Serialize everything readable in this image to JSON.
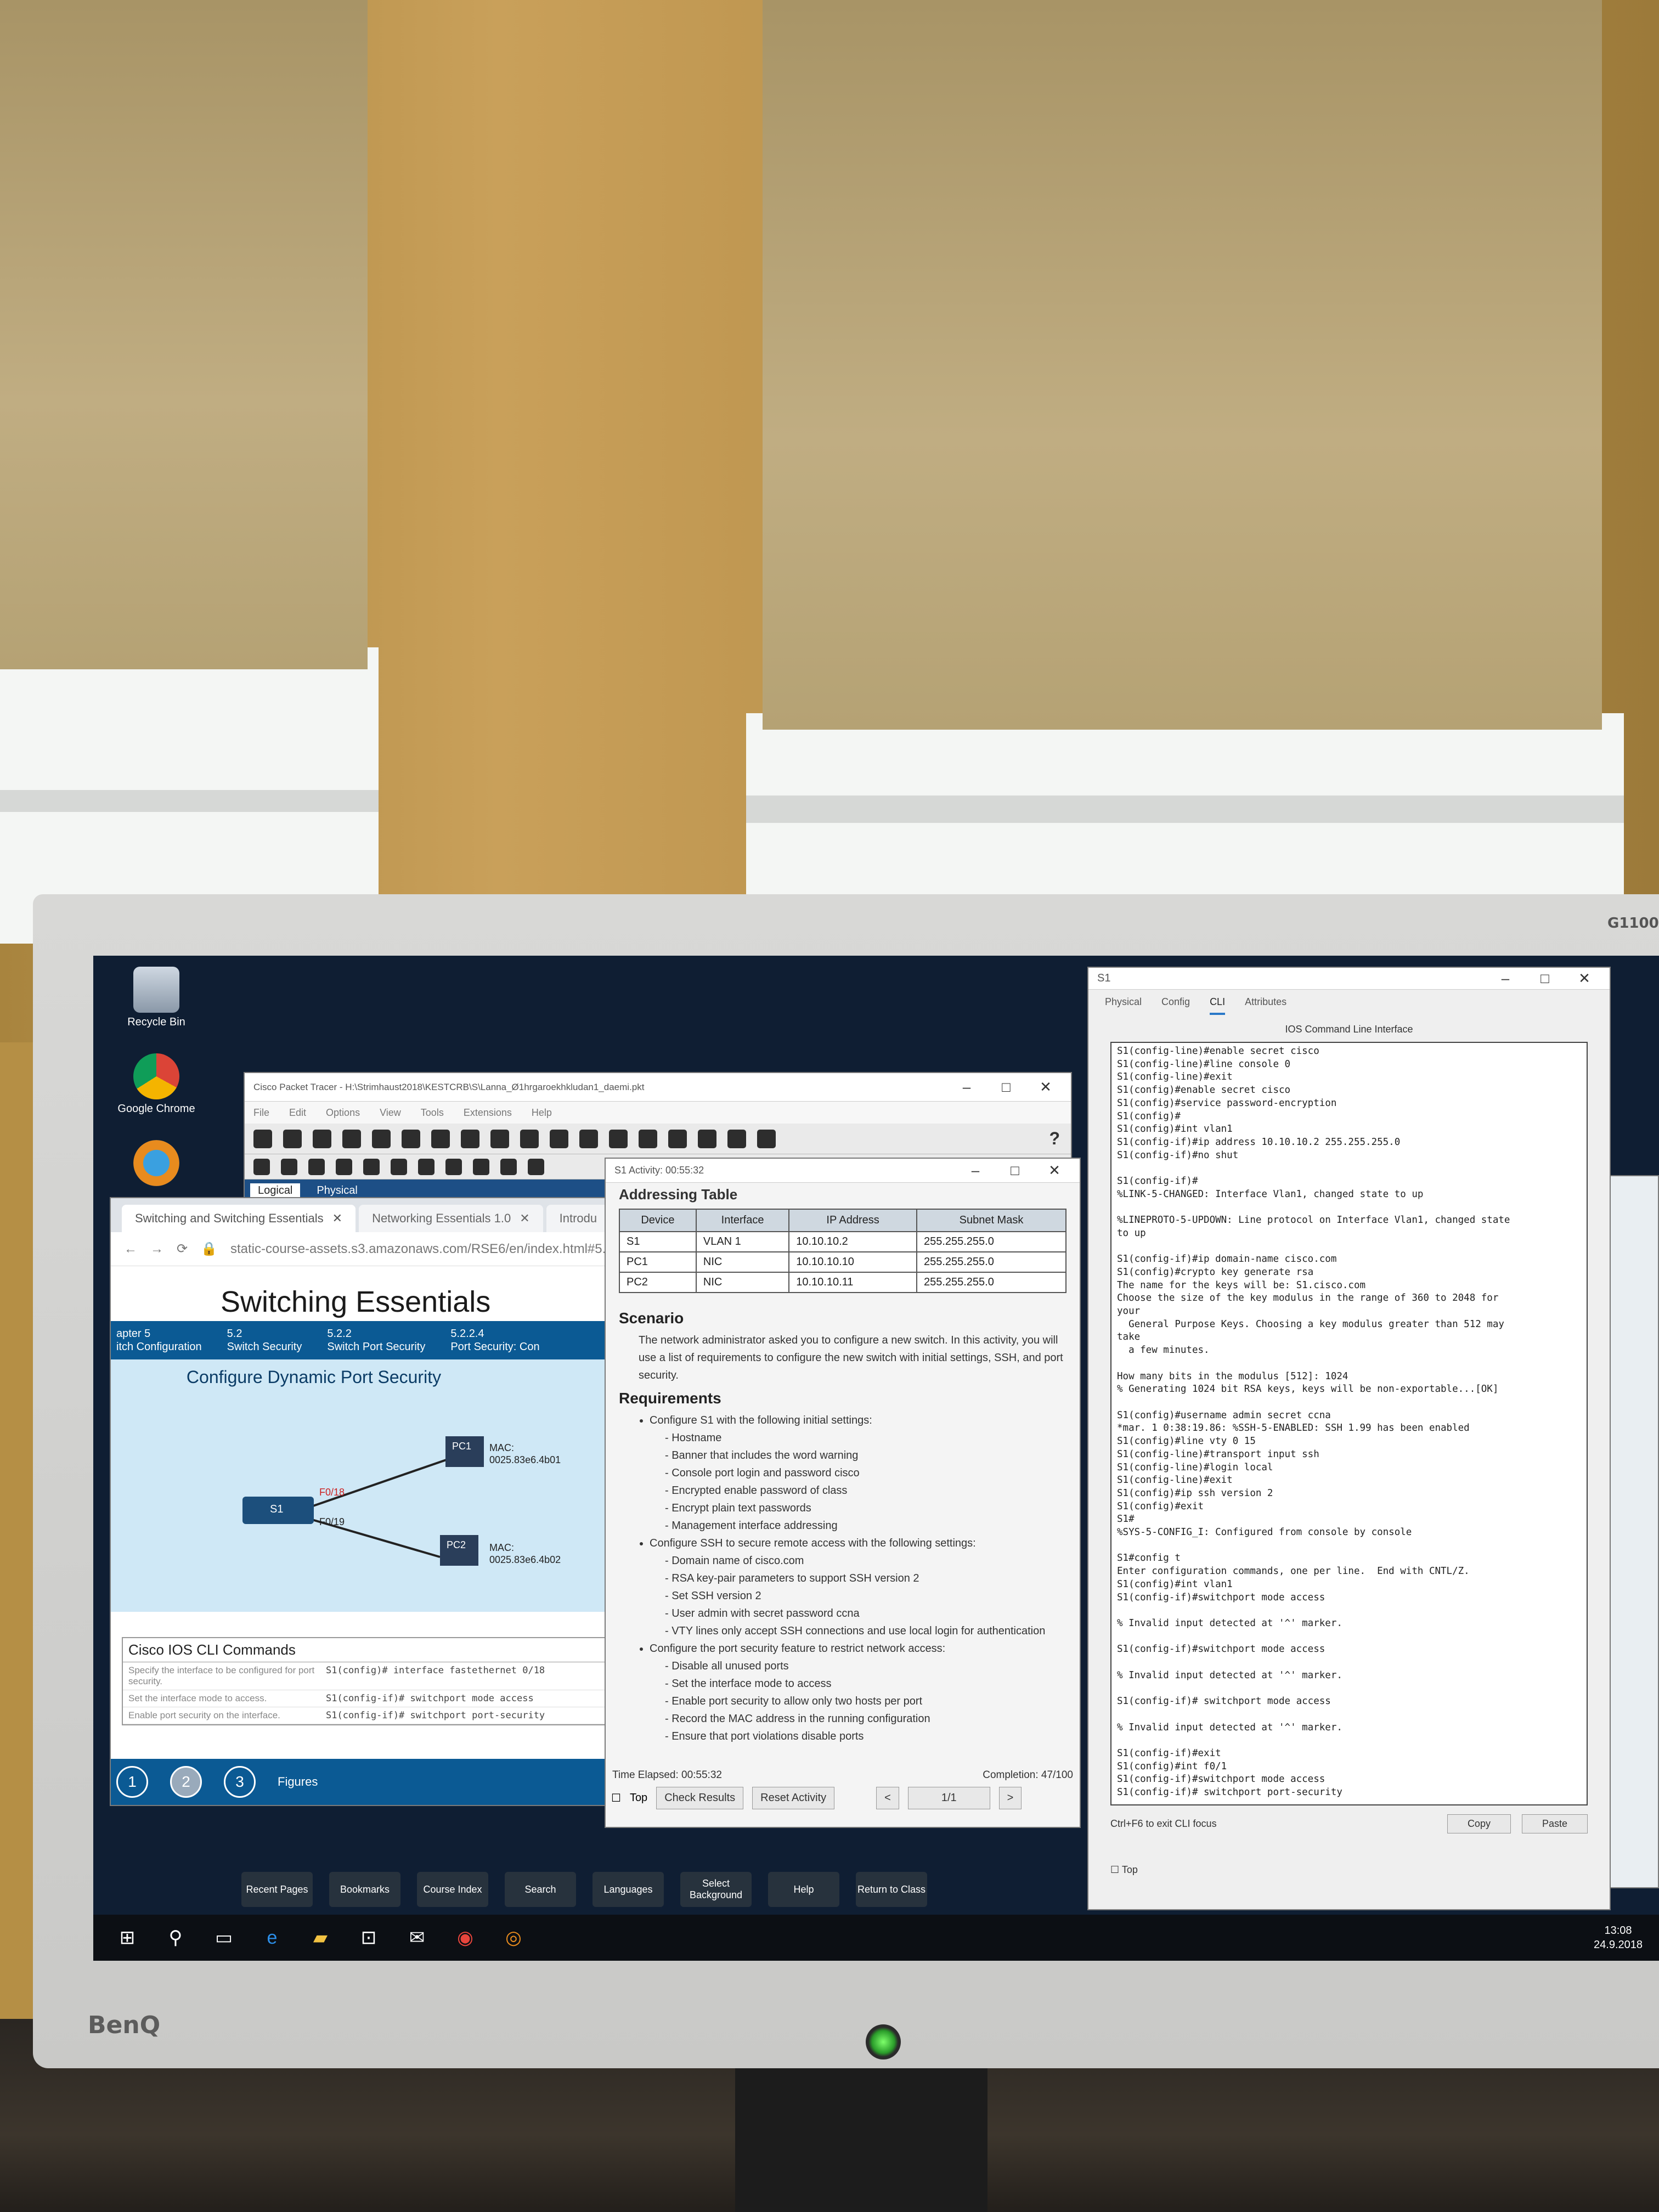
{
  "monitor": {
    "brand": "BenQ",
    "model": "G1100"
  },
  "desktop_icons": [
    {
      "label": "Recycle Bin",
      "icon": "recycle-bin-icon"
    },
    {
      "label": "Google Chrome",
      "icon": "chrome-icon"
    },
    {
      "label": "",
      "icon": "packet-tracer-icon"
    }
  ],
  "pt_window": {
    "title": "Cisco Packet Tracer - H:\\Strimhaust2018\\KESTCRB\\S\\Lanna_Ø1hrgaroekhkludan1_daemi.pkt",
    "menu": [
      "File",
      "Edit",
      "Options",
      "View",
      "Tools",
      "Extensions",
      "Help"
    ],
    "tabs": [
      "Logical",
      "Physical"
    ]
  },
  "browser": {
    "tabs": [
      "Switching and Switching Essentials",
      "Networking Essentials 1.0",
      "Introdu"
    ],
    "url": "static-course-assets.s3.amazonaws.com/RSE6/en/index.html#5.2.2.4",
    "course_title": "Switching Essentials",
    "breadcrumbs": [
      {
        "num": "apter 5",
        "label": "itch Configuration"
      },
      {
        "num": "5.2",
        "label": "Switch Security"
      },
      {
        "num": "5.2.2",
        "label": "Switch Port Security"
      },
      {
        "num": "5.2.2.4",
        "label": "Port Security: Con"
      }
    ],
    "figure_title": "Configure Dynamic Port Security",
    "topology": {
      "switch": "S1",
      "ports": [
        "F0/18",
        "F0/19"
      ],
      "pcs": [
        {
          "name": "PC1",
          "mac_label": "MAC:",
          "mac": "0025.83e6.4b01"
        },
        {
          "name": "PC2",
          "mac_label": "MAC:",
          "mac": "0025.83e6.4b02"
        }
      ]
    },
    "cli_commands": {
      "title": "Cisco IOS CLI Commands",
      "rows": [
        {
          "desc": "Specify the interface to be configured for port security.",
          "cmd": "S1(config)# interface fastethernet 0/18"
        },
        {
          "desc": "Set the interface mode to access.",
          "cmd": "S1(config-if)# switchport mode access"
        },
        {
          "desc": "Enable port security on the interface.",
          "cmd": "S1(config-if)# switchport port-security"
        }
      ]
    },
    "footer": {
      "pages": [
        "1",
        "2",
        "3"
      ],
      "label": "Figures"
    }
  },
  "activity": {
    "title": "S1 Activity: 00:55:32",
    "addressing_title": "Addressing Table",
    "table_headers": [
      "Device",
      "Interface",
      "IP Address",
      "Subnet Mask"
    ],
    "table_rows": [
      [
        "S1",
        "VLAN 1",
        "10.10.10.2",
        "255.255.255.0"
      ],
      [
        "PC1",
        "NIC",
        "10.10.10.10",
        "255.255.255.0"
      ],
      [
        "PC2",
        "NIC",
        "10.10.10.11",
        "255.255.255.0"
      ]
    ],
    "scenario_heading": "Scenario",
    "scenario_text": "The network administrator asked you to configure a new switch. In this activity, you will use a list of requirements to configure the new switch with initial settings, SSH, and port security.",
    "requirements_heading": "Requirements",
    "requirements": [
      {
        "text": "Configure S1 with the following initial settings:",
        "items": [
          "Hostname",
          "Banner that includes the word warning",
          "Console port login and password cisco",
          "Encrypted enable password of class",
          "Encrypt plain text passwords",
          "Management interface addressing"
        ]
      },
      {
        "text": "Configure SSH to secure remote access with the following settings:",
        "items": [
          "Domain name of cisco.com",
          "RSA key-pair parameters to support SSH version 2",
          "Set SSH version 2",
          "User admin with secret password ccna",
          "VTY lines only accept SSH connections and use local login for authentication"
        ]
      },
      {
        "text": "Configure the port security feature to restrict network access:",
        "items": [
          "Disable all unused ports",
          "Set the interface mode to access",
          "Enable port security to allow only two hosts per port",
          "Record the MAC address in the running configuration",
          "Ensure that port violations disable ports"
        ]
      }
    ],
    "time_elapsed": "Time Elapsed: 00:55:32",
    "completion": "Completion: 47/100",
    "top_label": "Top",
    "check_results": "Check Results",
    "reset_activity": "Reset Activity",
    "prev": "<",
    "page": "1/1",
    "next": ">"
  },
  "course_nav": [
    "Recent Pages",
    "Bookmarks",
    "Course Index",
    "Search",
    "Languages",
    "Select Background",
    "Help",
    "Return to Class"
  ],
  "cli_window": {
    "title": "S1",
    "tabs": [
      "Physical",
      "Config",
      "CLI",
      "Attributes"
    ],
    "active_tab": "CLI",
    "ios_title": "IOS Command Line Interface",
    "lines": [
      "S1(config-line)#enable secret cisco",
      "S1(config-line)#line console 0",
      "S1(config-line)#exit",
      "S1(config)#enable secret cisco",
      "S1(config)#service password-encryption",
      "S1(config)#",
      "S1(config)#int vlan1",
      "S1(config-if)#ip address 10.10.10.2 255.255.255.0",
      "S1(config-if)#no shut",
      "",
      "S1(config-if)#",
      "%LINK-5-CHANGED: Interface Vlan1, changed state to up",
      "",
      "%LINEPROTO-5-UPDOWN: Line protocol on Interface Vlan1, changed state",
      "to up",
      "",
      "S1(config-if)#ip domain-name cisco.com",
      "S1(config)#crypto key generate rsa",
      "The name for the keys will be: S1.cisco.com",
      "Choose the size of the key modulus in the range of 360 to 2048 for",
      "your",
      "  General Purpose Keys. Choosing a key modulus greater than 512 may",
      "take",
      "  a few minutes.",
      "",
      "How many bits in the modulus [512]: 1024",
      "% Generating 1024 bit RSA keys, keys will be non-exportable...[OK]",
      "",
      "S1(config)#username admin secret ccna",
      "*mar. 1 0:38:19.86: %SSH-5-ENABLED: SSH 1.99 has been enabled",
      "S1(config)#line vty 0 15",
      "S1(config-line)#transport input ssh",
      "S1(config-line)#login local",
      "S1(config-line)#exit",
      "S1(config)#ip ssh version 2",
      "S1(config)#exit",
      "S1#",
      "%SYS-5-CONFIG_I: Configured from console by console",
      "",
      "S1#config t",
      "Enter configuration commands, one per line.  End with CNTL/Z.",
      "S1(config)#int vlan1",
      "S1(config-if)#switchport mode access",
      "",
      "% Invalid input detected at '^' marker.",
      "",
      "S1(config-if)#switchport mode access",
      "",
      "% Invalid input detected at '^' marker.",
      "",
      "S1(config-if)# switchport mode access",
      "",
      "% Invalid input detected at '^' marker.",
      "",
      "S1(config-if)#exit",
      "S1(config)#int f0/1",
      "S1(config-if)#switchport mode access",
      "S1(config-if)# switchport port-security"
    ],
    "hint": "Ctrl+F6 to exit CLI focus",
    "copy": "Copy",
    "paste": "Paste",
    "top_label": "Top"
  },
  "taskbar": {
    "icons": [
      "start-icon",
      "search-icon",
      "task-view-icon",
      "edge-icon",
      "file-explorer-icon",
      "store-icon",
      "mail-icon",
      "chrome-icon",
      "packet-tracer-icon"
    ],
    "time": "13:08",
    "date": "24.9.2018"
  },
  "colors": {
    "course_blue": "#0b5a94",
    "screen_bg": "#0f1e33",
    "bezel": "#d0d0ce"
  }
}
